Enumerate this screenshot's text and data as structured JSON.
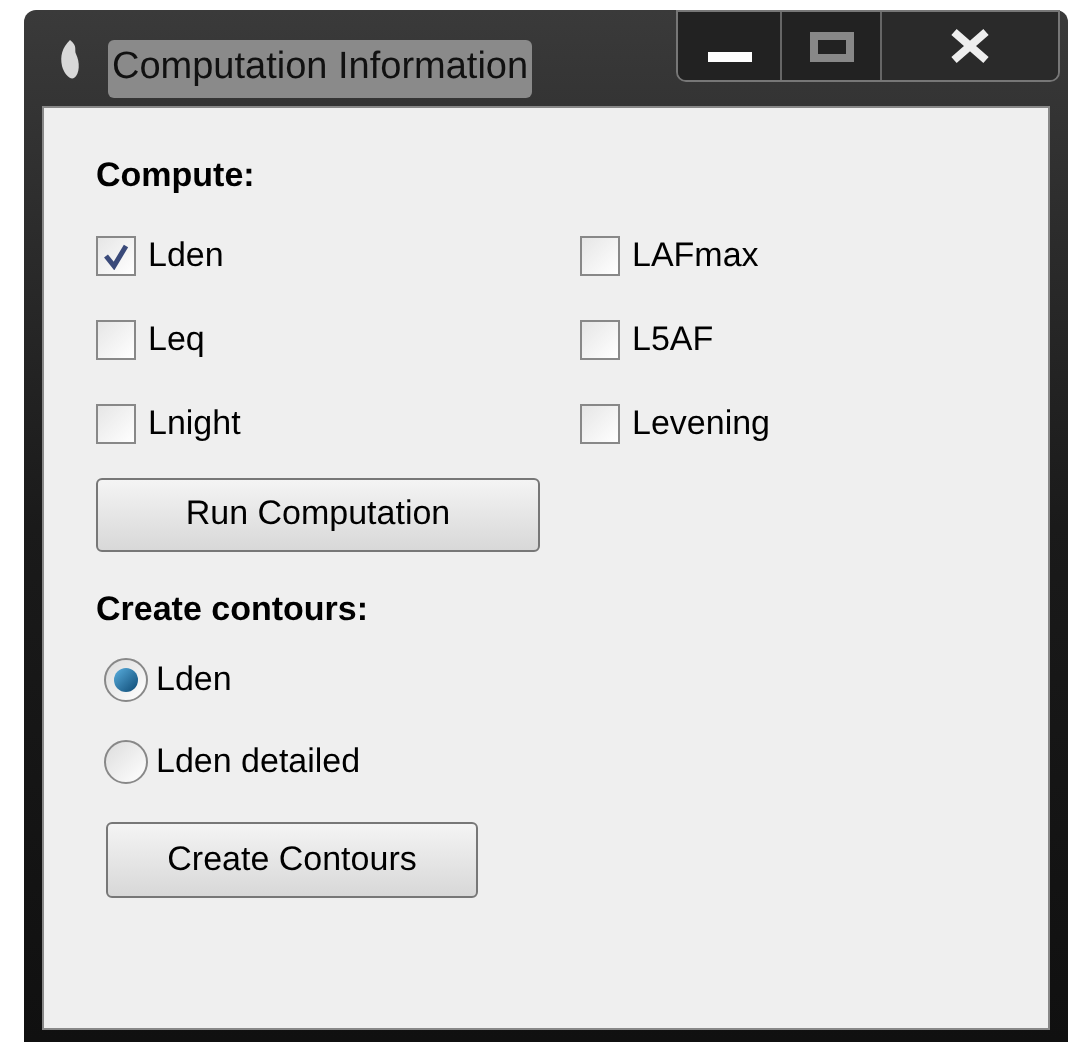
{
  "window": {
    "title": "Computation Information"
  },
  "compute": {
    "heading": "Compute:",
    "options": [
      {
        "label": "Lden",
        "checked": true
      },
      {
        "label": "LAFmax",
        "checked": false
      },
      {
        "label": "Leq",
        "checked": false
      },
      {
        "label": "L5AF",
        "checked": false
      },
      {
        "label": "Lnight",
        "checked": false
      },
      {
        "label": "Levening",
        "checked": false
      }
    ],
    "button": "Run Computation"
  },
  "contours": {
    "heading": "Create contours:",
    "options": [
      {
        "label": "Lden",
        "selected": true
      },
      {
        "label": "Lden detailed",
        "selected": false
      }
    ],
    "button": "Create Contours"
  }
}
